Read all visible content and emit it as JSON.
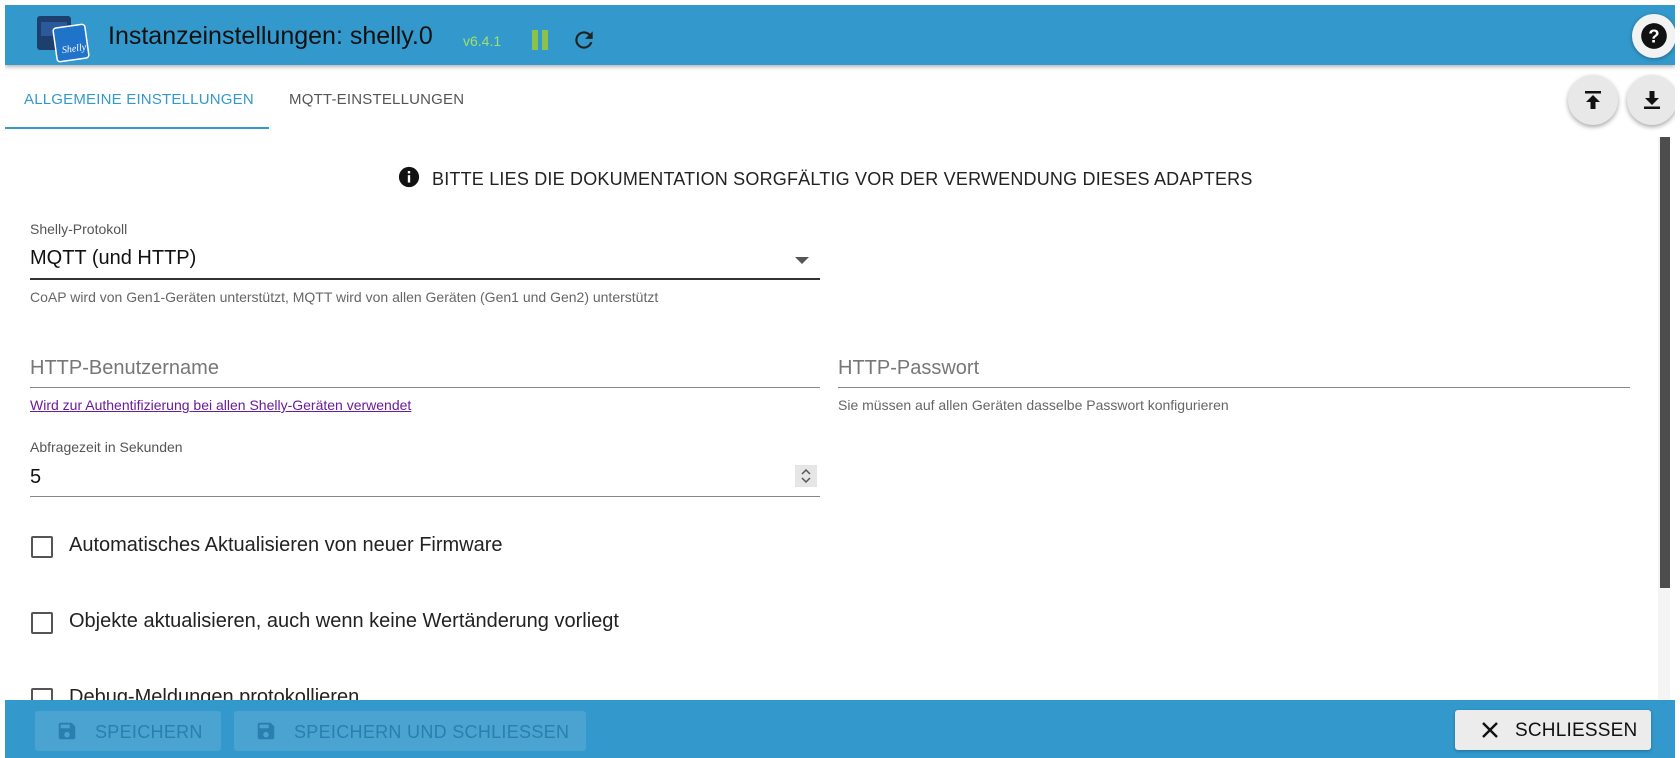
{
  "header": {
    "title": "Instanzeinstellungen: shelly.0",
    "version": "v6.4.1"
  },
  "tabs": [
    {
      "label": "ALLGEMEINE EINSTELLUNGEN",
      "active": true
    },
    {
      "label": "MQTT-EINSTELLUNGEN",
      "active": false
    }
  ],
  "info_banner": "BITTE LIES DIE DOKUMENTATION SORGFÄLTIG VOR DER VERWENDUNG DIESES ADAPTERS",
  "protocol": {
    "label": "Shelly-Protokoll",
    "value": "MQTT (und HTTP)",
    "helper": "CoAP wird von Gen1-Geräten unterstützt, MQTT wird von allen Geräten (Gen1 und Gen2) unterstützt"
  },
  "http_user": {
    "placeholder": "HTTP-Benutzername",
    "helper": "Wird zur Authentifizierung bei allen Shelly-Geräten verwendet"
  },
  "http_password": {
    "placeholder": "HTTP-Passwort",
    "helper": "Sie müssen auf allen Geräten dasselbe Passwort konfigurieren"
  },
  "poll_interval": {
    "label": "Abfragezeit in Sekunden",
    "value": "5"
  },
  "checkboxes": [
    {
      "label": "Automatisches Aktualisieren von neuer Firmware",
      "checked": false
    },
    {
      "label": "Objekte aktualisieren, auch wenn keine Wertänderung vorliegt",
      "checked": false
    },
    {
      "label": "Debug-Meldungen protokollieren",
      "checked": false
    }
  ],
  "footer": {
    "save": "SPEICHERN",
    "save_close": "SPEICHERN UND SCHLIESSEN",
    "close": "SCHLIESSEN"
  },
  "colors": {
    "accent": "#3399cc",
    "version_text": "#9ee06a",
    "pause_icon": "#8bc34a",
    "link": "#6a1b9a"
  },
  "icons": [
    "shelly-logo",
    "pause-icon",
    "reload-icon",
    "help-icon",
    "upload-icon",
    "download-icon",
    "info-icon",
    "dropdown-arrow-icon",
    "number-spinner-icon",
    "save-icon",
    "close-icon"
  ]
}
